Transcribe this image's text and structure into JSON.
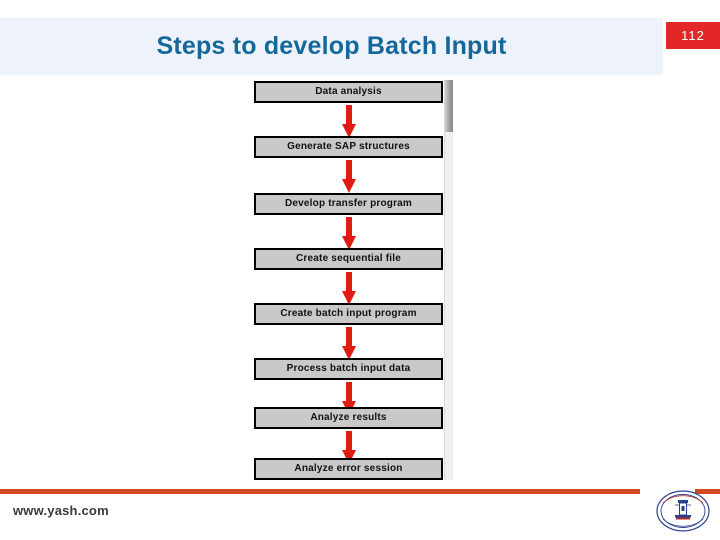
{
  "slide": {
    "title": "Steps to develop Batch Input",
    "page_number": "112",
    "accent_blue": "#14689b",
    "band_background": "#eef2fa",
    "badge_color": "#e32726",
    "footer_rule_color": "#d4491f",
    "arrow_color": "#e01b13",
    "node_fill": "#c9c9c9"
  },
  "flowchart": {
    "type": "flow",
    "steps": [
      {
        "label": "Data analysis"
      },
      {
        "label": "Generate SAP structures"
      },
      {
        "label": "Develop transfer program"
      },
      {
        "label": "Create sequential file"
      },
      {
        "label": "Create batch input program"
      },
      {
        "label": "Process batch input data"
      },
      {
        "label": "Analyze results"
      },
      {
        "label": "Analyze error session"
      }
    ]
  },
  "footer": {
    "url": "www.yash.com",
    "logo_name": "yash-technologies-emblem"
  }
}
